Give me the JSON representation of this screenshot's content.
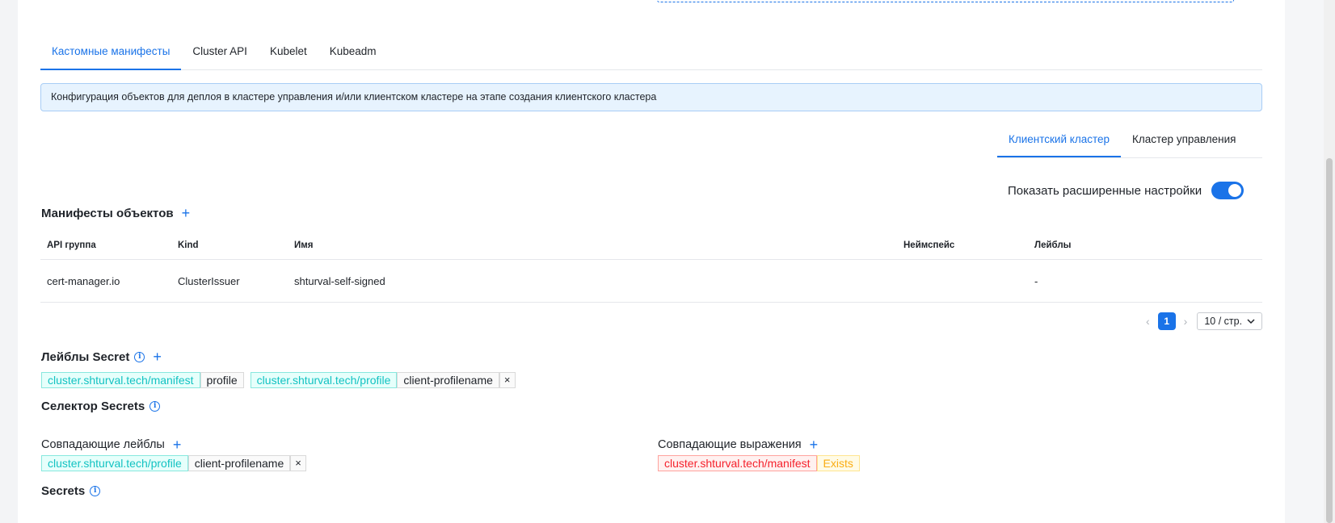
{
  "tabs": [
    {
      "label": "Кастомные манифесты",
      "active": true
    },
    {
      "label": "Cluster API",
      "active": false
    },
    {
      "label": "Kubelet",
      "active": false
    },
    {
      "label": "Kubeadm",
      "active": false
    }
  ],
  "info_banner": "Конфигурация объектов для деплоя в кластере управления и/или клиентском кластере на этапе создания клиентского кластера",
  "subtabs": [
    {
      "label": "Клиентский кластер",
      "active": true
    },
    {
      "label": "Кластер управления",
      "active": false
    }
  ],
  "advanced_toggle": {
    "label": "Показать расширенные настройки",
    "on": true
  },
  "manifests": {
    "title": "Манифесты объектов",
    "columns": [
      "API группа",
      "Kind",
      "Имя",
      "Неймспейс",
      "Лейблы"
    ],
    "rows": [
      {
        "api_group": "cert-manager.io",
        "kind": "ClusterIssuer",
        "name": "shturval-self-signed",
        "namespace": "",
        "labels": "-"
      }
    ]
  },
  "pagination": {
    "current": "1",
    "page_size": "10 / стр."
  },
  "secret_labels": {
    "title": "Лейблы Secret",
    "items": [
      {
        "key": "cluster.shturval.tech/manifest",
        "value": "profile"
      },
      {
        "key": "cluster.shturval.tech/profile",
        "value": "client-profilename",
        "close": "×"
      }
    ]
  },
  "selector": {
    "title": "Селектор Secrets",
    "match_labels": {
      "title": "Совпадающие лейблы",
      "items": [
        {
          "key": "cluster.shturval.tech/profile",
          "value": "client-profilename",
          "close": "×"
        }
      ]
    },
    "match_expressions": {
      "title": "Совпадающие выражения",
      "items": [
        {
          "key": "cluster.shturval.tech/manifest",
          "operator": "Exists"
        }
      ]
    }
  },
  "secrets": {
    "title": "Secrets"
  },
  "icons": {
    "plus": "plus-icon",
    "info": "info-icon",
    "close": "close-icon",
    "chevron": "chevron-down-icon"
  },
  "colors": {
    "accent": "#1a73e8",
    "banner_bg": "#e7f3fe",
    "tag_key": "#13c2c2",
    "tag_red": "#f5222d",
    "tag_gold": "#faad14"
  }
}
